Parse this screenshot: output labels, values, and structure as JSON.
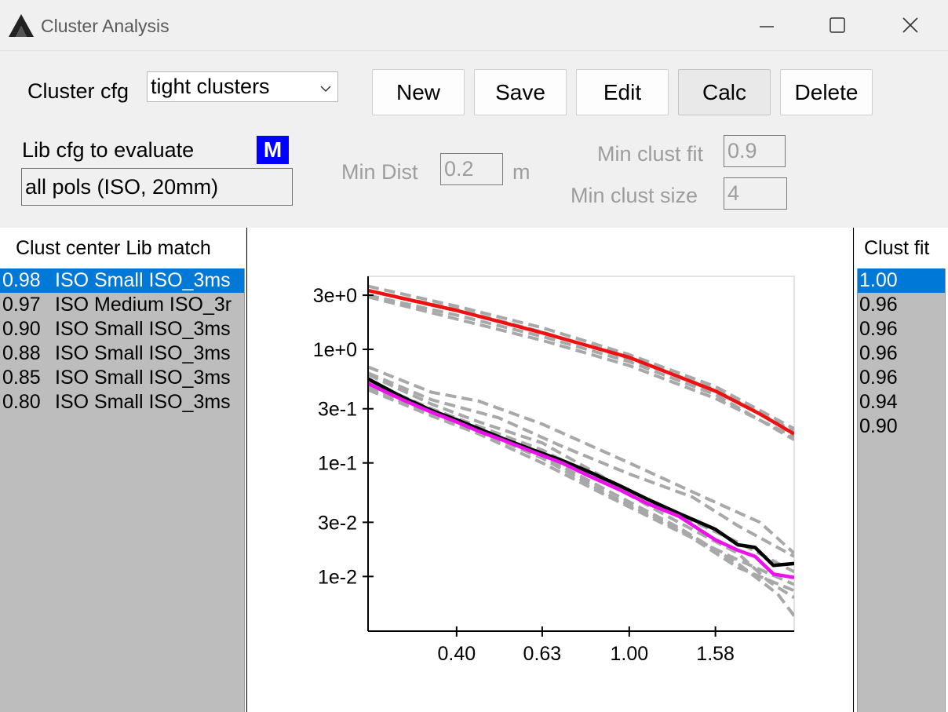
{
  "window": {
    "title": "Cluster Analysis"
  },
  "cluster_cfg": {
    "label": "Cluster cfg",
    "selected": "tight clusters"
  },
  "buttons": {
    "new": "New",
    "save": "Save",
    "edit": "Edit",
    "calc": "Calc",
    "delete": "Delete"
  },
  "lib_cfg": {
    "label": "Lib cfg to evaluate",
    "badge": "M",
    "value": "all pols (ISO, 20mm)"
  },
  "min_dist": {
    "label": "Min Dist",
    "value": "0.2",
    "unit": "m"
  },
  "min_clust_fit": {
    "label": "Min clust fit",
    "value": "0.9"
  },
  "min_clust_size": {
    "label": "Min clust size",
    "value": "4"
  },
  "lib_match": {
    "header": "Clust center Lib match",
    "rows": [
      {
        "value": "0.98",
        "name": "ISO Small ISO_3ms"
      },
      {
        "value": "0.97",
        "name": "ISO Medium ISO_3r"
      },
      {
        "value": "0.90",
        "name": "ISO Small ISO_3ms"
      },
      {
        "value": "0.88",
        "name": "ISO Small ISO_3ms"
      },
      {
        "value": "0.85",
        "name": "ISO Small ISO_3ms"
      },
      {
        "value": "0.80",
        "name": "ISO Small ISO_3ms"
      }
    ]
  },
  "clust_fit": {
    "header": "Clust fit",
    "rows": [
      "1.00",
      "0.96",
      "0.96",
      "0.96",
      "0.96",
      "0.94",
      "0.90"
    ]
  },
  "colors": {
    "selection": "#0078d7",
    "badge": "#0000ff",
    "series_red": "#ee1111",
    "series_black": "#000000",
    "series_magenta": "#ee11ee",
    "series_gray": "#a8a8a8"
  },
  "chart_data": {
    "type": "line",
    "x_scale": "log",
    "y_scale": "log",
    "xlim": [
      0.25,
      2.4
    ],
    "ylim": [
      0.0033,
      4.4
    ],
    "x_ticks": [
      0.4,
      0.63,
      1.0,
      1.58
    ],
    "x_tick_labels": [
      "0.40",
      "0.63",
      "1.00",
      "1.58"
    ],
    "y_ticks": [
      3,
      1,
      0.3,
      0.1,
      0.03,
      0.01
    ],
    "y_tick_labels": [
      "3e+0",
      "1e+0",
      "3e-1",
      "1e-1",
      "3e-2",
      "1e-2"
    ],
    "grid": false,
    "series": [
      {
        "color": "red",
        "x": [
          0.25,
          0.4,
          0.63,
          1.0,
          1.58,
          2.0,
          2.4
        ],
        "y": [
          3.3,
          2.2,
          1.4,
          0.85,
          0.43,
          0.27,
          0.18
        ]
      },
      {
        "color": "black",
        "x": [
          0.25,
          0.3,
          0.35,
          0.4,
          0.45,
          0.52,
          0.6,
          0.7,
          0.8,
          0.95,
          1.1,
          1.3,
          1.58,
          1.78,
          1.95,
          2.15,
          2.4
        ],
        "y": [
          0.55,
          0.38,
          0.29,
          0.24,
          0.2,
          0.16,
          0.13,
          0.105,
          0.085,
          0.063,
          0.048,
          0.036,
          0.026,
          0.019,
          0.018,
          0.0125,
          0.013
        ]
      },
      {
        "color": "magenta",
        "x": [
          0.25,
          0.3,
          0.35,
          0.4,
          0.45,
          0.52,
          0.6,
          0.7,
          0.8,
          0.95,
          1.1,
          1.3,
          1.58,
          1.78,
          1.95,
          2.15,
          2.4
        ],
        "y": [
          0.5,
          0.36,
          0.28,
          0.23,
          0.19,
          0.155,
          0.125,
          0.1,
          0.078,
          0.058,
          0.044,
          0.034,
          0.021,
          0.017,
          0.015,
          0.0105,
          0.0098
        ]
      },
      {
        "color": "gray",
        "dashed": true,
        "x": [
          0.25,
          0.4,
          0.63,
          1.0,
          1.58,
          2.4
        ],
        "y": [
          3.6,
          2.4,
          1.55,
          0.9,
          0.47,
          0.2
        ]
      },
      {
        "color": "gray",
        "dashed": true,
        "x": [
          0.25,
          0.4,
          0.63,
          1.0,
          1.58,
          2.4
        ],
        "y": [
          3.0,
          2.0,
          1.3,
          0.78,
          0.4,
          0.16
        ]
      },
      {
        "color": "gray",
        "dashed": true,
        "x": [
          0.25,
          0.4,
          0.63,
          1.0,
          1.58,
          2.4
        ],
        "y": [
          3.3,
          2.25,
          1.42,
          0.83,
          0.44,
          0.19
        ]
      },
      {
        "color": "gray",
        "dashed": true,
        "x": [
          0.25,
          0.4,
          0.63,
          1.0,
          1.58,
          2.4
        ],
        "y": [
          2.9,
          1.85,
          1.2,
          0.72,
          0.37,
          0.17
        ]
      },
      {
        "color": "gray",
        "dashed": true,
        "x": [
          0.25,
          0.35,
          0.45,
          0.63,
          1.0,
          1.58,
          2.0,
          2.4
        ],
        "y": [
          0.7,
          0.42,
          0.35,
          0.22,
          0.1,
          0.045,
          0.03,
          0.016
        ]
      },
      {
        "color": "gray",
        "dashed": true,
        "x": [
          0.25,
          0.35,
          0.5,
          0.7,
          1.0,
          1.4,
          1.78,
          2.4
        ],
        "y": [
          0.62,
          0.36,
          0.25,
          0.14,
          0.08,
          0.05,
          0.028,
          0.015
        ]
      },
      {
        "color": "gray",
        "dashed": true,
        "x": [
          0.25,
          0.35,
          0.45,
          0.63,
          0.9,
          1.3,
          1.78,
          2.4
        ],
        "y": [
          0.6,
          0.33,
          0.23,
          0.15,
          0.07,
          0.035,
          0.02,
          0.011
        ]
      },
      {
        "color": "gray",
        "dashed": true,
        "x": [
          0.25,
          0.35,
          0.45,
          0.63,
          0.9,
          1.3,
          1.78,
          2.1,
          2.4
        ],
        "y": [
          0.52,
          0.3,
          0.21,
          0.13,
          0.065,
          0.03,
          0.016,
          0.009,
          0.0065
        ]
      },
      {
        "color": "gray",
        "dashed": true,
        "x": [
          0.25,
          0.35,
          0.45,
          0.63,
          0.9,
          1.3,
          1.78,
          2.2,
          2.4
        ],
        "y": [
          0.48,
          0.28,
          0.195,
          0.115,
          0.056,
          0.027,
          0.013,
          0.007,
          0.0045
        ]
      },
      {
        "color": "gray",
        "dashed": true,
        "x": [
          0.25,
          0.35,
          0.45,
          0.63,
          0.9,
          1.3,
          1.78,
          2.4
        ],
        "y": [
          0.46,
          0.27,
          0.19,
          0.11,
          0.052,
          0.026,
          0.012,
          0.0075
        ]
      },
      {
        "color": "gray",
        "dashed": true,
        "x": [
          0.25,
          0.35,
          0.45,
          0.63,
          0.9,
          1.3,
          1.78,
          2.4
        ],
        "y": [
          0.44,
          0.26,
          0.18,
          0.1,
          0.05,
          0.025,
          0.014,
          0.0085
        ]
      }
    ]
  }
}
